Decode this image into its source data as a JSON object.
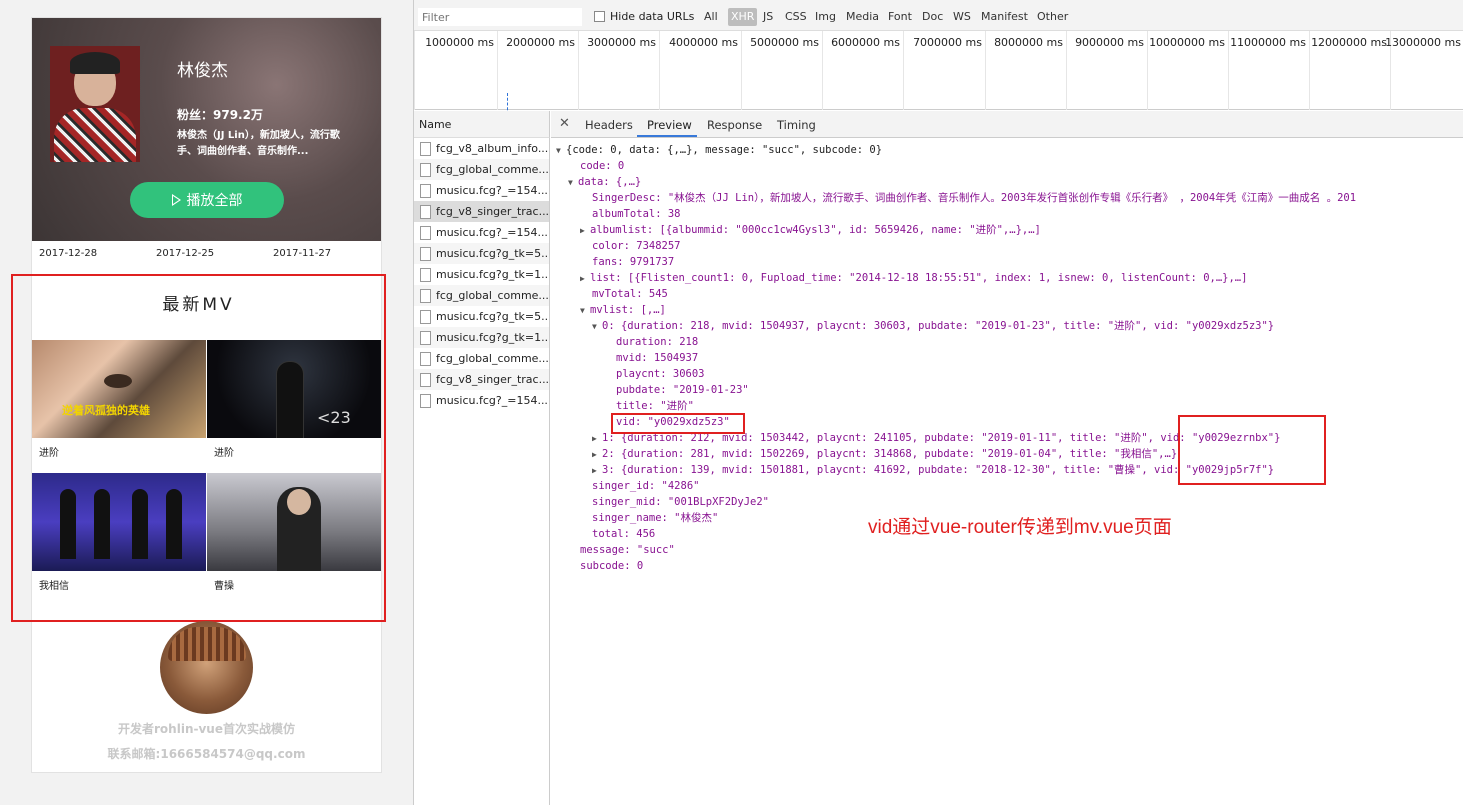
{
  "app": {
    "singer": {
      "name": "林俊杰",
      "fans": "粉丝：979.2万",
      "desc": "林俊杰（JJ Lin），新加坡人，流行歌手、词曲创作者、音乐制作..."
    },
    "play_all_label": "播放全部",
    "dates": [
      "2017-12-28",
      "2017-12-25",
      "2017-11-27"
    ],
    "mv_section_title": "最新MV",
    "mvs": [
      {
        "label": "进阶",
        "caption": "逆着风孤独的英雄"
      },
      {
        "label": "进阶",
        "caption": "<23"
      },
      {
        "label": "我相信",
        "caption": ""
      },
      {
        "label": "曹操",
        "caption": ""
      }
    ],
    "developer_credit": "开发者rohlin-vue首次实战模仿",
    "developer_email": "联系邮箱:1666584574@qq.com"
  },
  "devtools": {
    "filter_placeholder": "Filter",
    "hide_data_urls": "Hide data URLs",
    "type_filters": [
      "All",
      "XHR",
      "JS",
      "CSS",
      "Img",
      "Media",
      "Font",
      "Doc",
      "WS",
      "Manifest",
      "Other"
    ],
    "active_type": "XHR",
    "timeline_ticks": [
      "1000000 ms",
      "2000000 ms",
      "3000000 ms",
      "4000000 ms",
      "5000000 ms",
      "6000000 ms",
      "7000000 ms",
      "8000000 ms",
      "9000000 ms",
      "10000000 ms",
      "11000000 ms",
      "12000000 ms",
      "13000000 ms"
    ],
    "name_header": "Name",
    "requests": [
      "fcg_v8_album_info...",
      "fcg_global_comme...",
      "musicu.fcg?_=154...",
      "fcg_v8_singer_trac...",
      "musicu.fcg?_=154...",
      "musicu.fcg?g_tk=5...",
      "musicu.fcg?g_tk=1...",
      "fcg_global_comme...",
      "musicu.fcg?g_tk=5...",
      "musicu.fcg?g_tk=1...",
      "fcg_global_comme...",
      "fcg_v8_singer_trac...",
      "musicu.fcg?_=154..."
    ],
    "selected_request": 3,
    "detail_tabs": [
      "Headers",
      "Preview",
      "Response",
      "Timing"
    ],
    "active_detail_tab": "Preview",
    "preview_lines": [
      "{code: 0, data: {,…}, message: \"succ\", subcode: 0}",
      "code: 0",
      "data: {,…}",
      "SingerDesc: \"林俊杰（JJ Lin），新加坡人，流行歌手、词曲创作者、音乐制作人。2003年发行首张创作专辑《乐行者》  ，2004年凭《江南》一曲成名  。201",
      "albumTotal: 38",
      "albumlist: [{albummid: \"000cc1cw4Gysl3\", id: 5659426, name: \"进阶\",…},…]",
      "color: 7348257",
      "fans: 9791737",
      "list: [{Flisten_count1: 0, Fupload_time: \"2014-12-18 18:55:51\", index: 1, isnew: 0, listenCount: 0,…},…]",
      "mvTotal: 545",
      "mvlist: [,…]",
      "0: {duration: 218, mvid: 1504937, playcnt: 30603, pubdate: \"2019-01-23\", title: \"进阶\", vid: \"y0029xdz5z3\"}",
      "duration: 218",
      "mvid: 1504937",
      "playcnt: 30603",
      "pubdate: \"2019-01-23\"",
      "title: \"进阶\"",
      "vid: \"y0029xdz5z3\"",
      "1: {duration: 212, mvid: 1503442, playcnt: 241105, pubdate: \"2019-01-11\", title: \"进阶\", vid: \"y0029ezrnbx\"}",
      "2: {duration: 281, mvid: 1502269, playcnt: 314868, pubdate: \"2019-01-04\", title: \"我相信\",…}",
      "3: {duration: 139, mvid: 1501881, playcnt: 41692, pubdate: \"2018-12-30\", title: \"曹操\", vid: \"y0029jp5r7f\"}",
      "singer_id: \"4286\"",
      "singer_mid: \"001BLpXF2DyJe2\"",
      "singer_name: \"林俊杰\"",
      "total: 456",
      "message: \"succ\"",
      "subcode: 0"
    ],
    "annotation": "vid通过vue-router传递到mv.vue页面"
  },
  "colors": {
    "accent_green": "#31c27c",
    "highlight_red": "#e02020",
    "devtools_blue": "#3879d9"
  }
}
